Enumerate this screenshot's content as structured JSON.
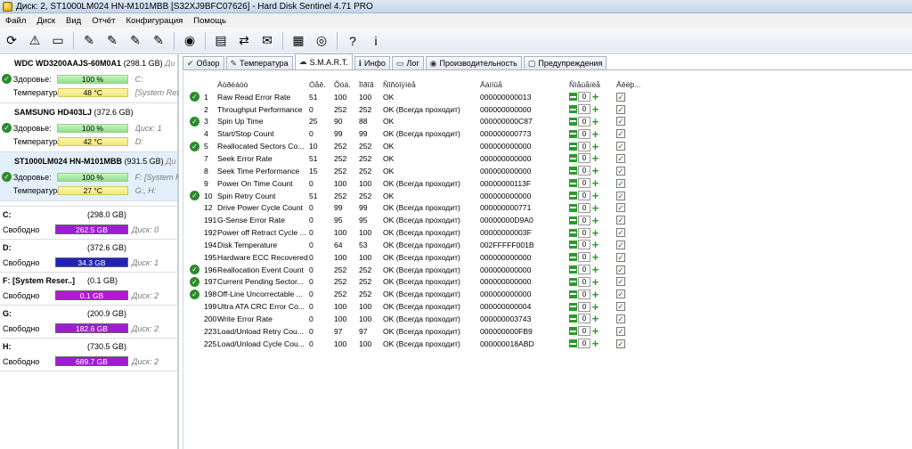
{
  "window": {
    "title": "Диск: 2, ST1000LM024 HN-M101MBB [S32XJ9BFC07626]  -  Hard Disk Sentinel 4.71 PRO"
  },
  "menu": [
    "Файл",
    "Диск",
    "Вид",
    "Отчёт",
    "Конфигурация",
    "Помощь"
  ],
  "toolbar": {
    "buttons": [
      "refresh-icon",
      "warning-icon",
      "drive-icon",
      "drive-tool-icon",
      "drive-tool-icon",
      "drive-tool-icon",
      "drive-tool-icon",
      "globe-icon",
      "report-icon",
      "transfer-icon",
      "email-icon",
      "chart-icon",
      "disc-icon",
      "help-icon",
      "info-icon"
    ],
    "glyphs": [
      "⟳",
      "⚠",
      "▭",
      "✎",
      "✎",
      "✎",
      "✎",
      "◉",
      "▤",
      "⇄",
      "✉",
      "▦",
      "◎",
      "?",
      "i"
    ]
  },
  "disks": [
    {
      "name": "WDC WD3200AAJS-60M0A1",
      "capacity": "(298.1 GB)",
      "extra_name": "Ди",
      "health_label": "Здоровье:",
      "health": "100 %",
      "health_extra": "C:",
      "temp_label": "Температура:",
      "temp": "48 °C",
      "temp_extra": "[System Res"
    },
    {
      "name": "SAMSUNG HD403LJ",
      "capacity": "(372.6 GB)",
      "extra_name": "",
      "health_label": "Здоровье:",
      "health": "100 %",
      "health_extra": "Диск: 1",
      "temp_label": "Температура:",
      "temp": "42 °C",
      "temp_extra": "D:"
    },
    {
      "name": "ST1000LM024 HN-M101MBB",
      "capacity": "(931.5 GB)",
      "extra_name": "Ди",
      "health_label": "Здоровье:",
      "health": "100 %",
      "health_extra": "F: [System Res",
      "temp_label": "Температура:",
      "temp": "27 °C",
      "temp_extra": "G:, H:"
    }
  ],
  "volumes": [
    {
      "name": "C:",
      "capacity": "(298.0 GB)",
      "free_label": "Свободно",
      "free": "262.5 GB",
      "disk": "Диск: 0",
      "color": "#9b1fd0"
    },
    {
      "name": "D:",
      "capacity": "(372.6 GB)",
      "free_label": "Свободно",
      "free": "34.3 GB",
      "disk": "Диск: 1",
      "color": "#2222bb"
    },
    {
      "name": "F: [System Reser..]",
      "capacity": "(0.1 GB)",
      "free_label": "Свободно",
      "free": "0.1 GB",
      "disk": "Диск: 2",
      "color": "#b01ad0"
    },
    {
      "name": "G:",
      "capacity": "(200.9 GB)",
      "free_label": "Свободно",
      "free": "182.6 GB",
      "disk": "Диск: 2",
      "color": "#9b1fd0"
    },
    {
      "name": "H:",
      "capacity": "(730.5 GB)",
      "free_label": "Свободно",
      "free": "689.7 GB",
      "disk": "Диск: 2",
      "color": "#9b1fd0"
    }
  ],
  "tabs": [
    {
      "label": "Обзор",
      "icon": "check-icon",
      "glyph": "✔"
    },
    {
      "label": "Температура",
      "icon": "thermometer-icon",
      "glyph": "✎"
    },
    {
      "label": "S.M.A.R.T.",
      "icon": "smart-icon",
      "glyph": "☁"
    },
    {
      "label": "Инфо",
      "icon": "info-icon",
      "glyph": "ℹ"
    },
    {
      "label": "Лог",
      "icon": "log-icon",
      "glyph": "▭"
    },
    {
      "label": "Производительность",
      "icon": "performance-icon",
      "glyph": "◉"
    },
    {
      "label": "Предупреждения",
      "icon": "warnings-icon",
      "glyph": "▢"
    }
  ],
  "smart": {
    "headers": {
      "attribute": "Àòðèáóò",
      "current": "Òåê.",
      "worst": "Õóä.",
      "threshold": "Ïîðîã",
      "status": "Ñîñòîÿíèå",
      "raw": "Äàííûå",
      "offset": "Ñìåùåíèå",
      "enabled": "Âêëþ..."
    },
    "rows": [
      {
        "ok": true,
        "id": "1",
        "name": "Raw Read Error Rate",
        "cur": "51",
        "wor": "100",
        "thr": "100",
        "status": "OK",
        "raw": "000000000013",
        "offset": "0",
        "enabled": true
      },
      {
        "ok": false,
        "id": "2",
        "name": "Throughput Performance",
        "cur": "0",
        "wor": "252",
        "thr": "252",
        "status": "OK (Всегда проходит)",
        "raw": "000000000000",
        "offset": "0",
        "enabled": true
      },
      {
        "ok": true,
        "id": "3",
        "name": "Spin Up Time",
        "cur": "25",
        "wor": "90",
        "thr": "88",
        "status": "OK",
        "raw": "000000000C87",
        "offset": "0",
        "enabled": true
      },
      {
        "ok": false,
        "id": "4",
        "name": "Start/Stop Count",
        "cur": "0",
        "wor": "99",
        "thr": "99",
        "status": "OK (Всегда проходит)",
        "raw": "000000000773",
        "offset": "0",
        "enabled": true
      },
      {
        "ok": true,
        "id": "5",
        "name": "Reallocated Sectors Co...",
        "cur": "10",
        "wor": "252",
        "thr": "252",
        "status": "OK",
        "raw": "000000000000",
        "offset": "0",
        "enabled": true
      },
      {
        "ok": false,
        "id": "7",
        "name": "Seek Error Rate",
        "cur": "51",
        "wor": "252",
        "thr": "252",
        "status": "OK",
        "raw": "000000000000",
        "offset": "0",
        "enabled": true
      },
      {
        "ok": false,
        "id": "8",
        "name": "Seek Time Performance",
        "cur": "15",
        "wor": "252",
        "thr": "252",
        "status": "OK",
        "raw": "000000000000",
        "offset": "0",
        "enabled": true
      },
      {
        "ok": false,
        "id": "9",
        "name": "Power On Time Count",
        "cur": "0",
        "wor": "100",
        "thr": "100",
        "status": "OK (Всегда проходит)",
        "raw": "00000000113F",
        "offset": "0",
        "enabled": true
      },
      {
        "ok": true,
        "id": "10",
        "name": "Spin Retry Count",
        "cur": "51",
        "wor": "252",
        "thr": "252",
        "status": "OK",
        "raw": "000000000000",
        "offset": "0",
        "enabled": true
      },
      {
        "ok": false,
        "id": "12",
        "name": "Drive Power Cycle Count",
        "cur": "0",
        "wor": "99",
        "thr": "99",
        "status": "OK (Всегда проходит)",
        "raw": "000000000771",
        "offset": "0",
        "enabled": true
      },
      {
        "ok": false,
        "id": "191",
        "name": "G-Sense Error Rate",
        "cur": "0",
        "wor": "95",
        "thr": "95",
        "status": "OK (Всегда проходит)",
        "raw": "00000000D9A0",
        "offset": "0",
        "enabled": true
      },
      {
        "ok": false,
        "id": "192",
        "name": "Power off Retract Cycle ...",
        "cur": "0",
        "wor": "100",
        "thr": "100",
        "status": "OK (Всегда проходит)",
        "raw": "00000000003F",
        "offset": "0",
        "enabled": true
      },
      {
        "ok": false,
        "id": "194",
        "name": "Disk Temperature",
        "cur": "0",
        "wor": "64",
        "thr": "53",
        "status": "OK (Всегда проходит)",
        "raw": "002FFFFF001B",
        "offset": "0",
        "enabled": true
      },
      {
        "ok": false,
        "id": "195",
        "name": "Hardware ECC Recovered",
        "cur": "0",
        "wor": "100",
        "thr": "100",
        "status": "OK (Всегда проходит)",
        "raw": "000000000000",
        "offset": "0",
        "enabled": true
      },
      {
        "ok": true,
        "id": "196",
        "name": "Reallocation Event Count",
        "cur": "0",
        "wor": "252",
        "thr": "252",
        "status": "OK (Всегда проходит)",
        "raw": "000000000000",
        "offset": "0",
        "enabled": true
      },
      {
        "ok": true,
        "id": "197",
        "name": "Current Pending Sector...",
        "cur": "0",
        "wor": "252",
        "thr": "252",
        "status": "OK (Всегда проходит)",
        "raw": "000000000000",
        "offset": "0",
        "enabled": true
      },
      {
        "ok": true,
        "id": "198",
        "name": "Off-Line Uncorrectable ...",
        "cur": "0",
        "wor": "252",
        "thr": "252",
        "status": "OK (Всегда проходит)",
        "raw": "000000000000",
        "offset": "0",
        "enabled": true
      },
      {
        "ok": false,
        "id": "199",
        "name": "Ultra ATA CRC Error Co...",
        "cur": "0",
        "wor": "100",
        "thr": "100",
        "status": "OK (Всегда проходит)",
        "raw": "000000000004",
        "offset": "0",
        "enabled": true
      },
      {
        "ok": false,
        "id": "200",
        "name": "Write Error Rate",
        "cur": "0",
        "wor": "100",
        "thr": "100",
        "status": "OK (Всегда проходит)",
        "raw": "000000003743",
        "offset": "0",
        "enabled": true
      },
      {
        "ok": false,
        "id": "223",
        "name": "Load/Unload Retry Cou...",
        "cur": "0",
        "wor": "97",
        "thr": "97",
        "status": "OK (Всегда проходит)",
        "raw": "000000000FB9",
        "offset": "0",
        "enabled": true
      },
      {
        "ok": false,
        "id": "225",
        "name": "Load/Unload Cycle Cou...",
        "cur": "0",
        "wor": "100",
        "thr": "100",
        "status": "OK (Всегда проходит)",
        "raw": "000000018ABD",
        "offset": "0",
        "enabled": true
      }
    ]
  }
}
